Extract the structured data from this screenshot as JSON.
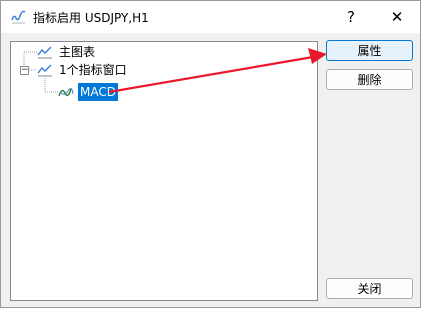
{
  "window": {
    "title": "指标启用 USDJPY,H1",
    "help_label": "?",
    "close_label": "✕"
  },
  "tree": {
    "items": [
      {
        "label": "主图表",
        "icon": "line-chart-icon"
      },
      {
        "label": "1个指标窗口",
        "icon": "line-chart-icon"
      },
      {
        "label": "MACD",
        "icon": "indicator-icon",
        "selected": true
      }
    ]
  },
  "buttons": {
    "properties": "属性",
    "delete": "删除",
    "close": "关闭"
  },
  "colors": {
    "selection": "#0078d7",
    "annotation_arrow": "#e8192c"
  }
}
